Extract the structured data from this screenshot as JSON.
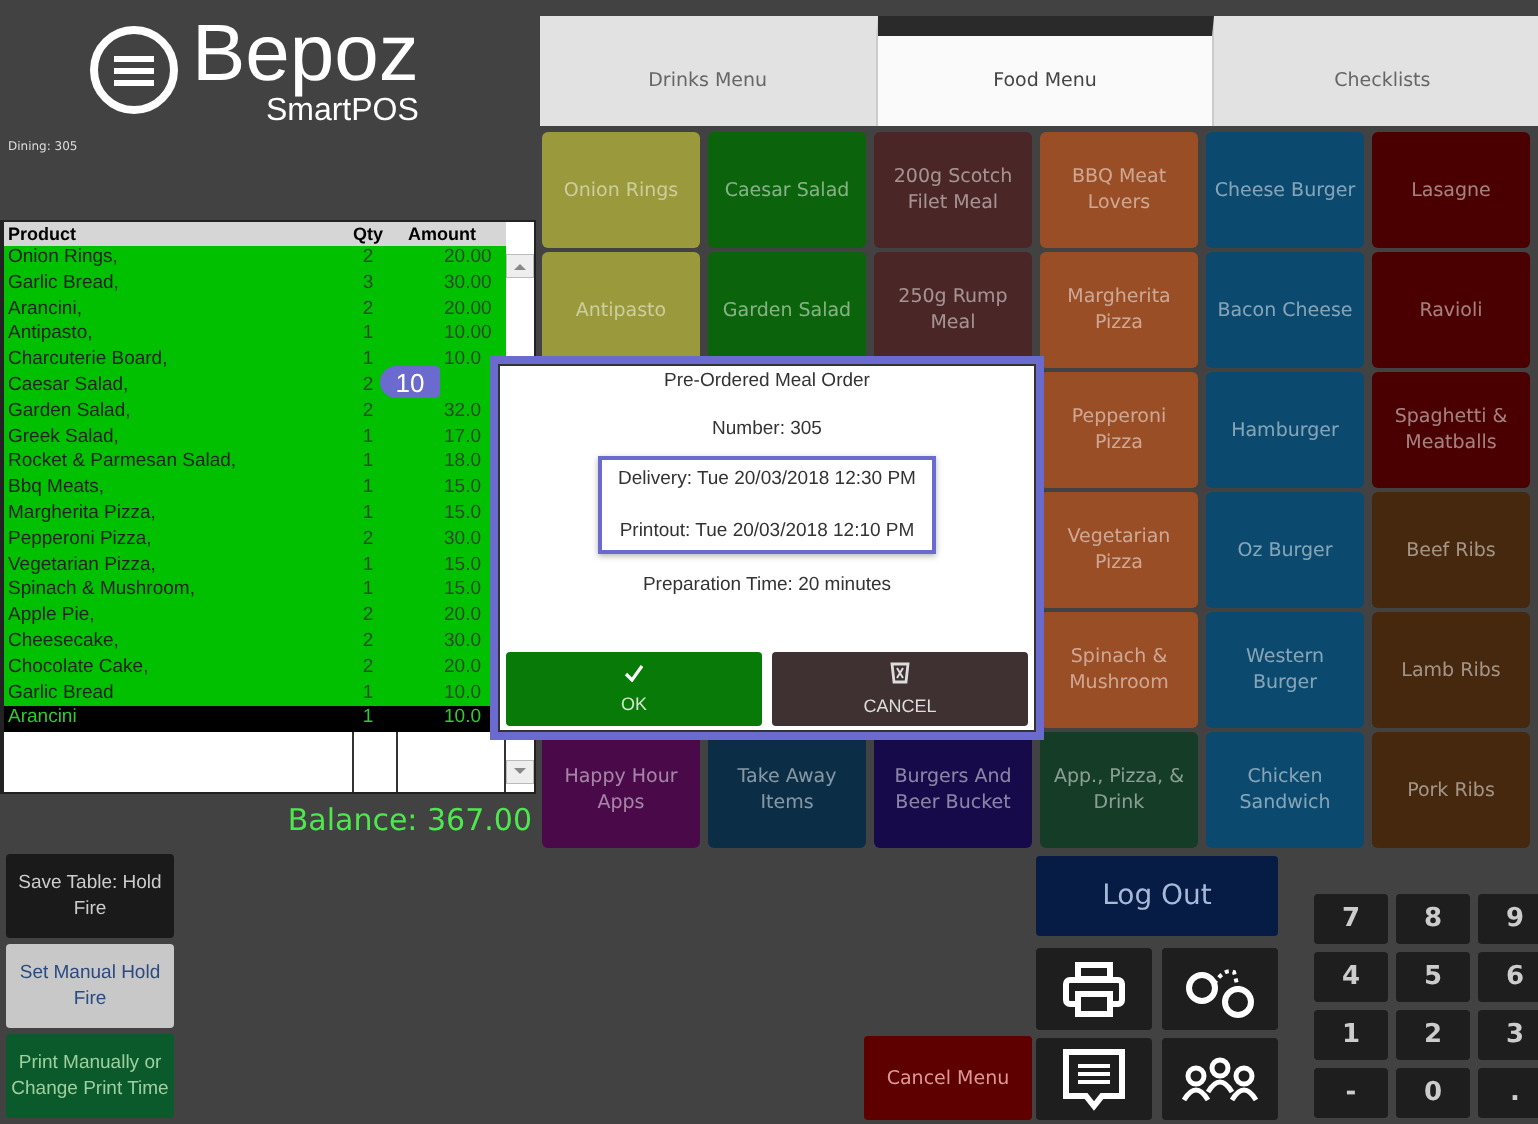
{
  "logo": {
    "name": "Bepoz",
    "sub": "SmartPOS"
  },
  "table_label": "Dining: 305",
  "order": {
    "columns": [
      "Product",
      "Qty",
      "Amount"
    ],
    "rows": [
      {
        "product": "Onion Rings,",
        "qty": "2",
        "amount": "20.00",
        "selected": false
      },
      {
        "product": "Garlic Bread,",
        "qty": "3",
        "amount": "30.00",
        "selected": false
      },
      {
        "product": "Arancini,",
        "qty": "2",
        "amount": "20.00",
        "selected": false
      },
      {
        "product": "Antipasto,",
        "qty": "1",
        "amount": "10.00",
        "selected": false
      },
      {
        "product": "Charcuterie Board,",
        "qty": "1",
        "amount": "10.0",
        "selected": false
      },
      {
        "product": "Caesar Salad,",
        "qty": "2",
        "selected": false
      },
      {
        "product": "Garden Salad,",
        "qty": "2",
        "amount": "32.0",
        "selected": false
      },
      {
        "product": "Greek Salad,",
        "qty": "1",
        "amount": "17.0",
        "selected": false
      },
      {
        "product": "Rocket & Parmesan Salad,",
        "qty": "1",
        "amount": "18.0",
        "selected": false
      },
      {
        "product": "Bbq Meats,",
        "qty": "1",
        "amount": "15.0",
        "selected": false
      },
      {
        "product": "Margherita Pizza,",
        "qty": "1",
        "amount": "15.0",
        "selected": false
      },
      {
        "product": "Pepperoni Pizza,",
        "qty": "2",
        "amount": "30.0",
        "selected": false
      },
      {
        "product": "Vegetarian Pizza,",
        "qty": "1",
        "amount": "15.0",
        "selected": false
      },
      {
        "product": "Spinach & Mushroom,",
        "qty": "1",
        "amount": "15.0",
        "selected": false
      },
      {
        "product": "Apple Pie,",
        "qty": "2",
        "amount": "20.0",
        "selected": false
      },
      {
        "product": "Cheesecake,",
        "qty": "2",
        "amount": "30.0",
        "selected": false
      },
      {
        "product": "Chocolate Cake,",
        "qty": "2",
        "amount": "20.0",
        "selected": false
      },
      {
        "product": "Garlic Bread",
        "qty": "1",
        "amount": "10.0",
        "selected": false
      },
      {
        "product": "Arancini",
        "qty": "1",
        "amount": "10.0",
        "selected": true
      }
    ]
  },
  "balance": "Balance: 367.00",
  "side_buttons": [
    {
      "label": "Save Table: Hold Fire",
      "color": "#1a1a1a"
    },
    {
      "label": "Set Manual Hold Fire",
      "color": "#c8c8c8"
    },
    {
      "label": "Print Manually or Change Print Time",
      "color": "#0b5a2c"
    }
  ],
  "tabs": [
    {
      "label": "Drinks Menu",
      "selected": false
    },
    {
      "label": "Food Menu",
      "selected": true
    },
    {
      "label": "Checklists",
      "selected": false
    }
  ],
  "tiles": [
    {
      "label": "Onion Rings",
      "color": "#9a9a3c"
    },
    {
      "label": "Caesar Salad",
      "color": "#0b640b"
    },
    {
      "label": "200g Scotch Filet Meal",
      "color": "#4a2626"
    },
    {
      "label": "BBQ Meat Lovers",
      "color": "#9a4e26"
    },
    {
      "label": "Cheese Burger",
      "color": "#0b4a6e"
    },
    {
      "label": "Lasagne",
      "color": "#4a0000"
    },
    {
      "label": "Antipasto",
      "color": "#9a9a3c"
    },
    {
      "label": "Garden Salad",
      "color": "#0b640b"
    },
    {
      "label": "250g Rump Meal",
      "color": "#4a2626"
    },
    {
      "label": "Margherita Pizza",
      "color": "#9a4e26"
    },
    {
      "label": "Bacon Cheese",
      "color": "#0b4a6e"
    },
    {
      "label": "Ravioli",
      "color": "#4a0000"
    },
    {
      "label": "Pepperoni Pizza",
      "color": "#9a4e26"
    },
    {
      "label": "Hamburger",
      "color": "#0b4a6e"
    },
    {
      "label": "Spaghetti & Meatballs",
      "color": "#4a0000"
    },
    {
      "label": "Vegetarian Pizza",
      "color": "#9a4e26"
    },
    {
      "label": "Oz Burger",
      "color": "#0b4a6e"
    },
    {
      "label": "Beef Ribs",
      "color": "#45280e"
    },
    {
      "label": "Spinach & Mushroom",
      "color": "#9a4e26"
    },
    {
      "label": "Western Burger",
      "color": "#0b4a6e"
    },
    {
      "label": "Lamb Ribs",
      "color": "#45280e"
    },
    {
      "label": "Happy Hour Apps",
      "color": "#4a0a4a"
    },
    {
      "label": "Take Away Items",
      "color": "#0b2e46"
    },
    {
      "label": "Burgers And Beer Bucket",
      "color": "#170a4a"
    },
    {
      "label": "App., Pizza, & Drink",
      "color": "#143c26"
    },
    {
      "label": "Chicken Sandwich",
      "color": "#0b4a6e"
    },
    {
      "label": "Pork Ribs",
      "color": "#45280e"
    }
  ],
  "cancel_menu": "Cancel Menu",
  "logout": "Log Out",
  "numpad": [
    "7",
    "8",
    "9",
    "4",
    "5",
    "6",
    "1",
    "2",
    "3",
    "-",
    "0",
    "."
  ],
  "dialog": {
    "title": "Pre-Ordered Meal Order",
    "number": "Number: 305",
    "delivery": "Delivery: Tue 20/03/2018 12:30 PM",
    "printout": "Printout: Tue 20/03/2018 12:10 PM",
    "prep": "Preparation Time: 20 minutes",
    "ok": "OK",
    "cancel": "CANCEL"
  },
  "callout": "10"
}
